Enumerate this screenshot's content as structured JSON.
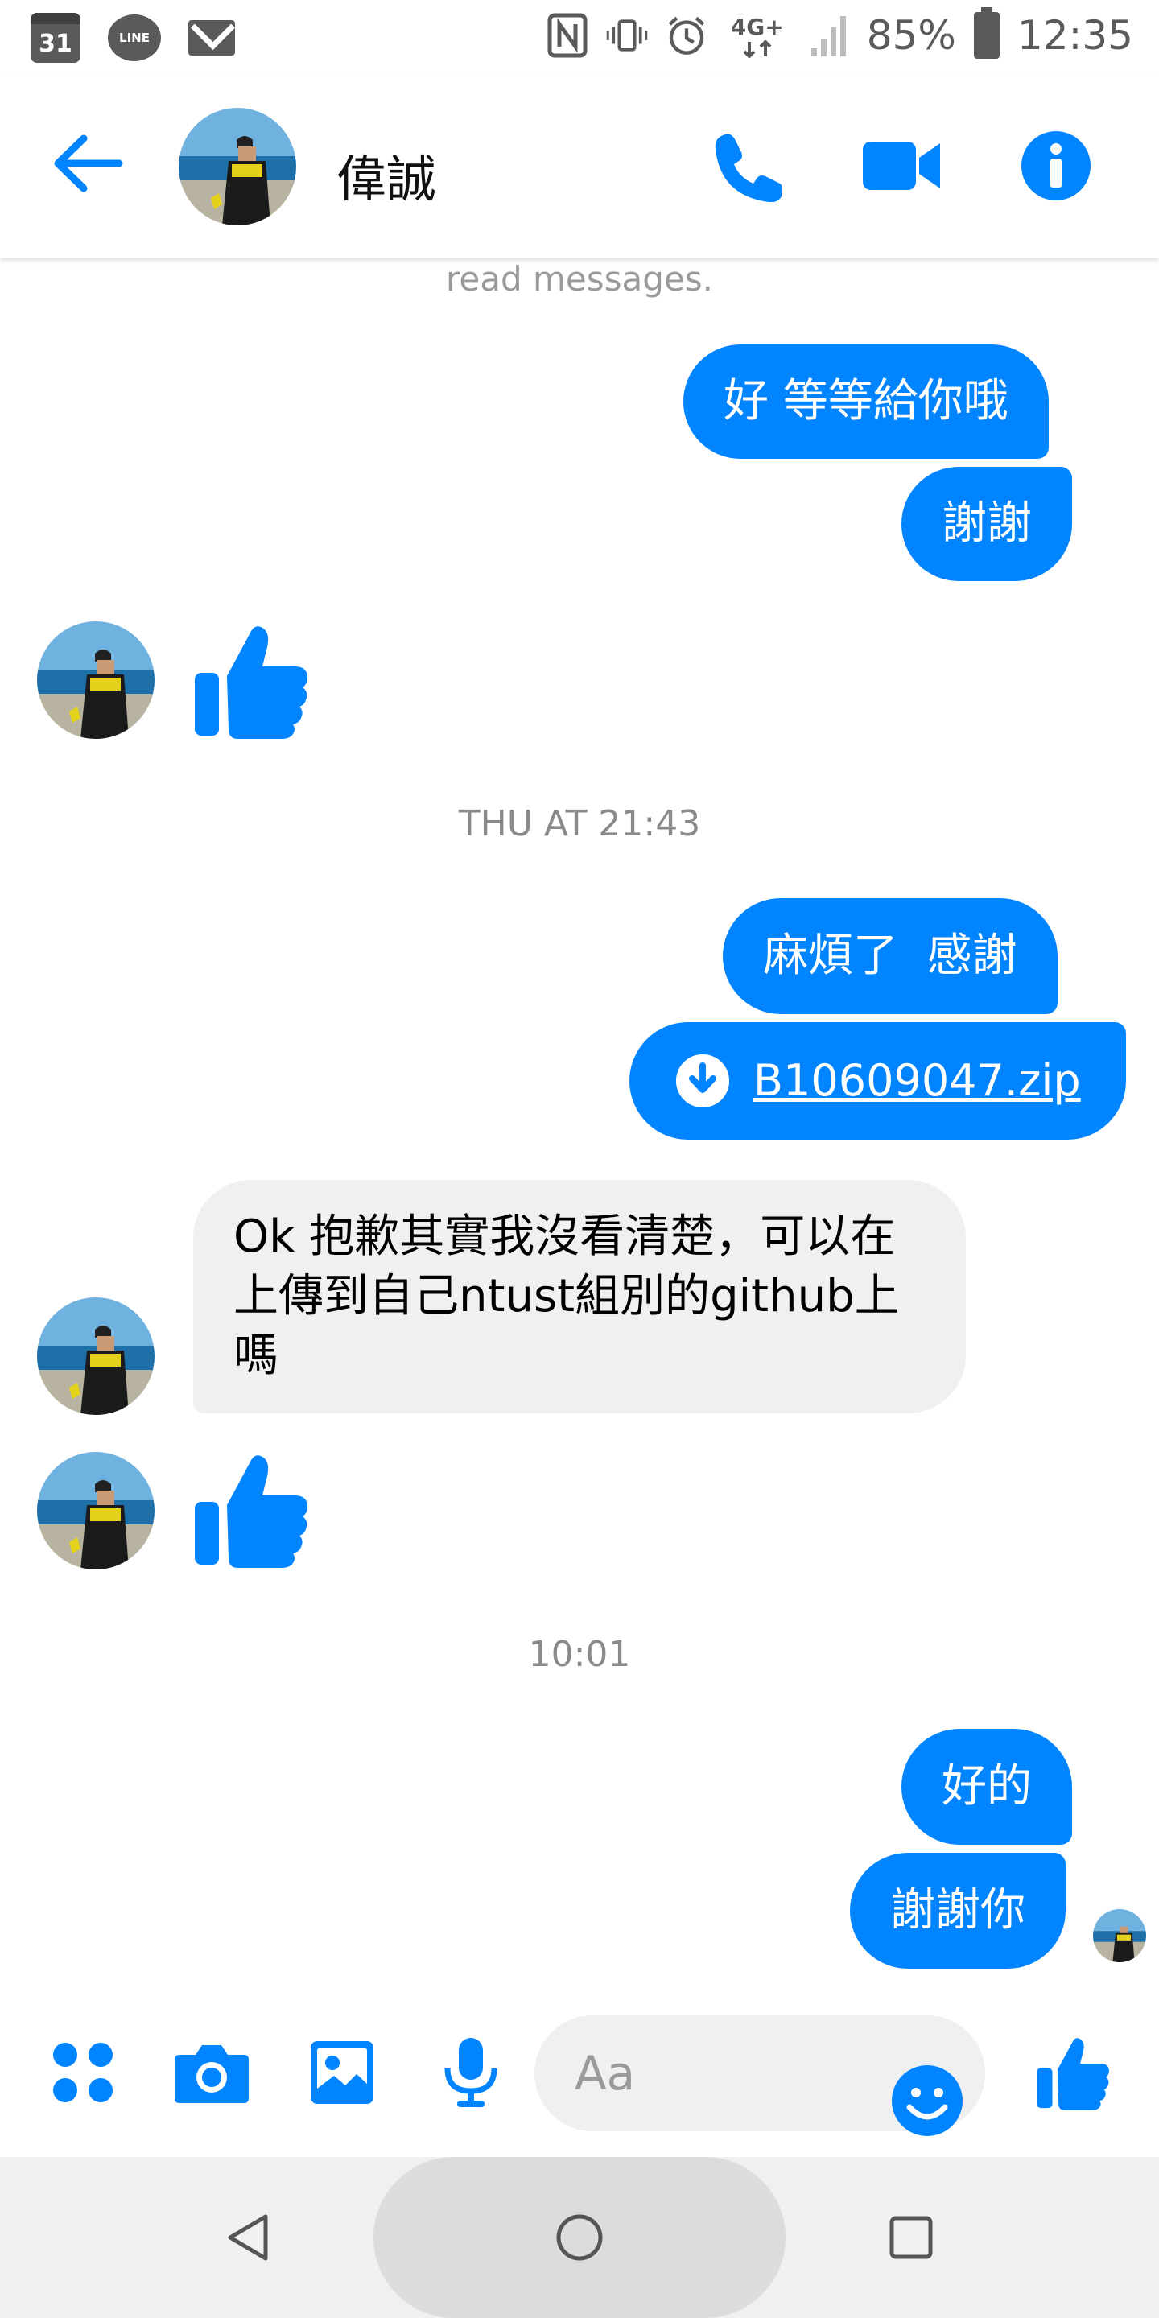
{
  "status_bar": {
    "calendar_day": "31",
    "line_label": "LINE",
    "network": "4G+",
    "battery": "85%",
    "time": "12:35"
  },
  "header": {
    "contact_name": "偉誠"
  },
  "chat": {
    "read_note": "read messages.",
    "messages": [
      {
        "from": "me",
        "text": "好 等等給你哦"
      },
      {
        "from": "me",
        "text": "謝謝"
      },
      {
        "from": "them",
        "type": "like"
      },
      {
        "type": "timestamp",
        "text": "THU AT 21:43"
      },
      {
        "from": "me",
        "text": "麻煩了  感謝"
      },
      {
        "from": "me",
        "type": "file",
        "text": "B10609047.zip"
      },
      {
        "from": "them",
        "text": "Ok 抱歉其實我沒看清楚，可以在上傳到自己ntust組別的github上嗎"
      },
      {
        "from": "them",
        "type": "like"
      },
      {
        "type": "timestamp",
        "text": "10:01"
      },
      {
        "from": "me",
        "text": "好的"
      },
      {
        "from": "me",
        "text": "謝謝你"
      }
    ]
  },
  "composer": {
    "placeholder": "Aa"
  },
  "colors": {
    "accent": "#0084ff",
    "incoming_bubble": "#f0f0f0"
  }
}
